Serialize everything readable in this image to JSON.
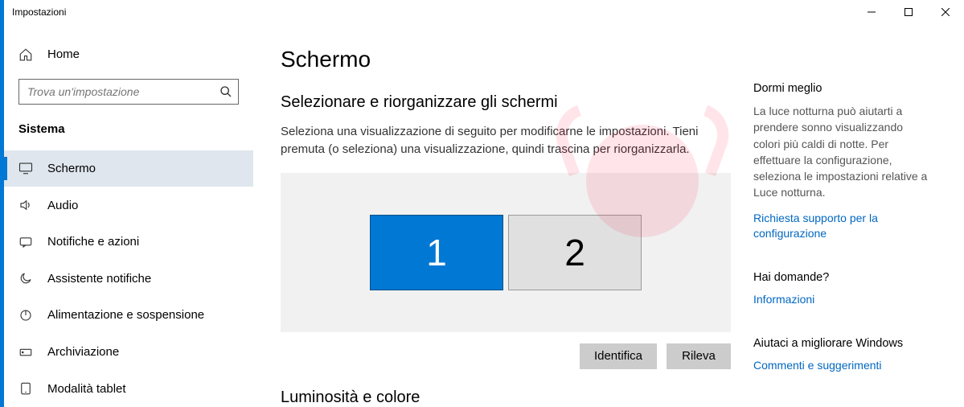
{
  "window": {
    "title": "Impostazioni"
  },
  "sidebar": {
    "home": "Home",
    "search_placeholder": "Trova un'impostazione",
    "category": "Sistema",
    "items": [
      {
        "label": "Schermo"
      },
      {
        "label": "Audio"
      },
      {
        "label": "Notifiche e azioni"
      },
      {
        "label": "Assistente notifiche"
      },
      {
        "label": "Alimentazione e sospensione"
      },
      {
        "label": "Archiviazione"
      },
      {
        "label": "Modalità tablet"
      }
    ]
  },
  "main": {
    "title": "Schermo",
    "arrange_title": "Selezionare e riorganizzare gli schermi",
    "arrange_desc": "Seleziona una visualizzazione di seguito per modificarne le impostazioni. Tieni premuta (o seleziona) una visualizzazione, quindi trascina per riorganizzarla.",
    "monitor1": "1",
    "monitor2": "2",
    "identify": "Identifica",
    "detect": "Rileva",
    "next_section": "Luminosità e colore"
  },
  "info": {
    "sleep_title": "Dormi meglio",
    "sleep_text": "La luce notturna può aiutarti a prendere sonno visualizzando colori più caldi di notte. Per effettuare la configurazione, seleziona le impostazioni relative a Luce notturna.",
    "sleep_link": "Richiesta supporto per la configurazione",
    "q_title": "Hai domande?",
    "q_link": "Informazioni",
    "fb_title": "Aiutaci a migliorare Windows",
    "fb_link": "Commenti e suggerimenti"
  }
}
